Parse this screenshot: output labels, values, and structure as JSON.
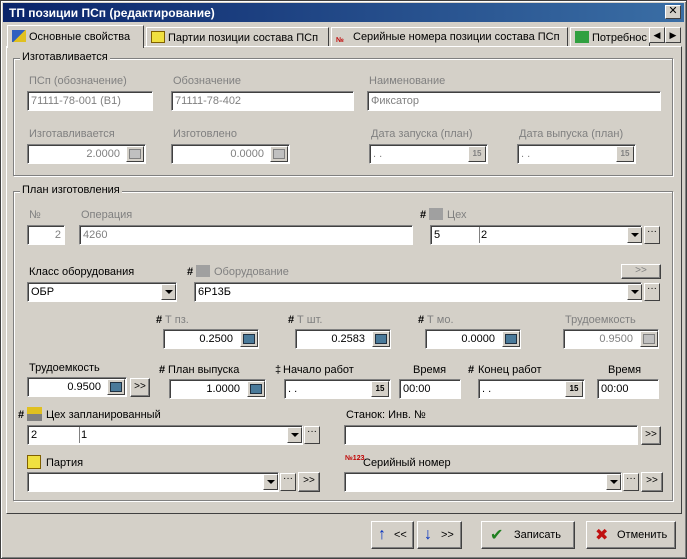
{
  "window": {
    "title": "ТП позиции ПСп (редактирование)",
    "close": "✕"
  },
  "tabs": [
    {
      "label": "Основные свойства",
      "active": true
    },
    {
      "label": "Партии позиции состава ПСп"
    },
    {
      "label": "Серийные номера позиции состава ПСп"
    },
    {
      "label": "Потребнос"
    }
  ],
  "made": {
    "title": "Изготавливается",
    "psp_label": "ПСп (обозначение)",
    "psp_value": "71111-78-001 (В1)",
    "designation_label": "Обозначение",
    "designation_value": "71111-78-402",
    "name_label": "Наименование",
    "name_value": "Фиксатор",
    "qty_made_label": "Изготавливается",
    "qty_made_value": "2.0000",
    "qty_done_label": "Изготовлено",
    "qty_done_value": "0.0000",
    "start_label": "Дата запуска (план)",
    "start_value": ". .",
    "release_label": "Дата выпуска (план)",
    "release_value": ". ."
  },
  "plan": {
    "title": "План изготовления",
    "num_label": "№",
    "num_value": "2",
    "op_label": "Операция",
    "op_value": "4260",
    "shop_hash": "#",
    "shop_label": "Цех",
    "shop_code": "5",
    "shop_name": "2",
    "eqclass_label": "Класс оборудования",
    "eqclass_value": "ОБР",
    "eq_hash": "#",
    "eq_label": "Оборудование",
    "eq_value": "6Р13Б",
    "eq_more": ">>",
    "tpz_label": "Т пз.",
    "tpz_value": "0.2500",
    "tsht_label": "Т шт.",
    "tsht_value": "0.2583",
    "tmo_label": "Т мо.",
    "tmo_value": "0.0000",
    "labor1_label": "Трудоемкость",
    "labor1_value": "0.9500",
    "labor2_label": "Трудоемкость",
    "labor2_value": "0.9500",
    "labor_more": ">>",
    "plan_out_label": "План выпуска",
    "plan_out_value": "1.0000",
    "work_start_label": "Начало работ",
    "work_start_value": ". .",
    "time1_label": "Время",
    "time1_value": "00:00",
    "work_end_label": "Конец работ",
    "work_end_value": ". .",
    "time2_label": "Время",
    "time2_value": "00:00",
    "plshop_label": "Цех запланированный",
    "plshop_code": "2",
    "plshop_name": "1",
    "machine_label": "Станок: Инв. №",
    "machine_value": "",
    "machine_more": ">>",
    "batch_label": "Партия",
    "batch_value": "",
    "batch_more": ">>",
    "serial_label": "Серийный номер",
    "serial_value": "",
    "serial_more": ">>"
  },
  "footer": {
    "prev": "<<",
    "next": ">>",
    "save": "Записать",
    "cancel": "Отменить"
  },
  "hashes": {
    "tpz": "#",
    "tsht": "#",
    "tmo": "#",
    "plan_out": "#",
    "work_start": "‡",
    "work_end": "#",
    "plshop": "#"
  },
  "ellipsis": "···",
  "cal_glyph": "15"
}
